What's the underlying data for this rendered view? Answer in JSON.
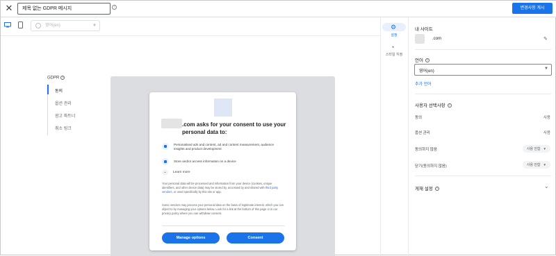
{
  "header": {
    "close_icon": "close-icon",
    "title_value": "제목 없는 GDPR 메시지",
    "help_icon": "help-icon",
    "publish_label": "변경사항 게시",
    "accent": "#1a73e8"
  },
  "toolbar": {
    "desktop_icon": "desktop-icon",
    "mobile_icon": "mobile-icon",
    "language_placeholder": "영어(en)"
  },
  "nav": {
    "title": "GDPR",
    "items": [
      {
        "label": "동의"
      },
      {
        "label": "옵션 관리"
      },
      {
        "label": "광고 파트너"
      },
      {
        "label": "취소 링크"
      }
    ]
  },
  "dialog": {
    "headline": ".com asks for your consent to use your personal data to:",
    "purposes": [
      {
        "icon": "person-icon",
        "text": "Personalised ads and content, ad and content measurement, audience insights and product development"
      },
      {
        "icon": "device-icon",
        "text": "Store and/or access information on a device"
      }
    ],
    "learn_more": "Learn more",
    "para1": "Your personal data will be processed and information from your device (cookies, unique identifiers, and other device data) may be stored by, accessed by and shared with third party vendors, or used specifically by this site or app.",
    "para1_link": "third party vendors",
    "para2": "Some vendors may process your personal data on the basis of legitimate interest, which you can object to by managing your options below. Look for a link at the bottom of this page or in our privacy policy where you can withdraw consent.",
    "manage_label": "Manage options",
    "consent_label": "Consent"
  },
  "rail": {
    "settings_label": "설정",
    "style_label": "스타일 지정"
  },
  "panel": {
    "my_site_title": "내 사이트",
    "site_domain": ".com",
    "language_title": "언어",
    "language_value": "영어(en)",
    "add_language": "추가 언어",
    "user_choices_title": "사용자 선택사항",
    "rows": [
      {
        "label": "동의",
        "value": "사용"
      },
      {
        "label": "옵션 관리",
        "value": "사용"
      }
    ],
    "do_not_consent_label": "동의하지 않음",
    "do_not_consent_value": "사용 안함",
    "close_label": "닫기(동의하지 않음)",
    "close_value": "사용 안함",
    "targeting_title": "게재 설정"
  }
}
